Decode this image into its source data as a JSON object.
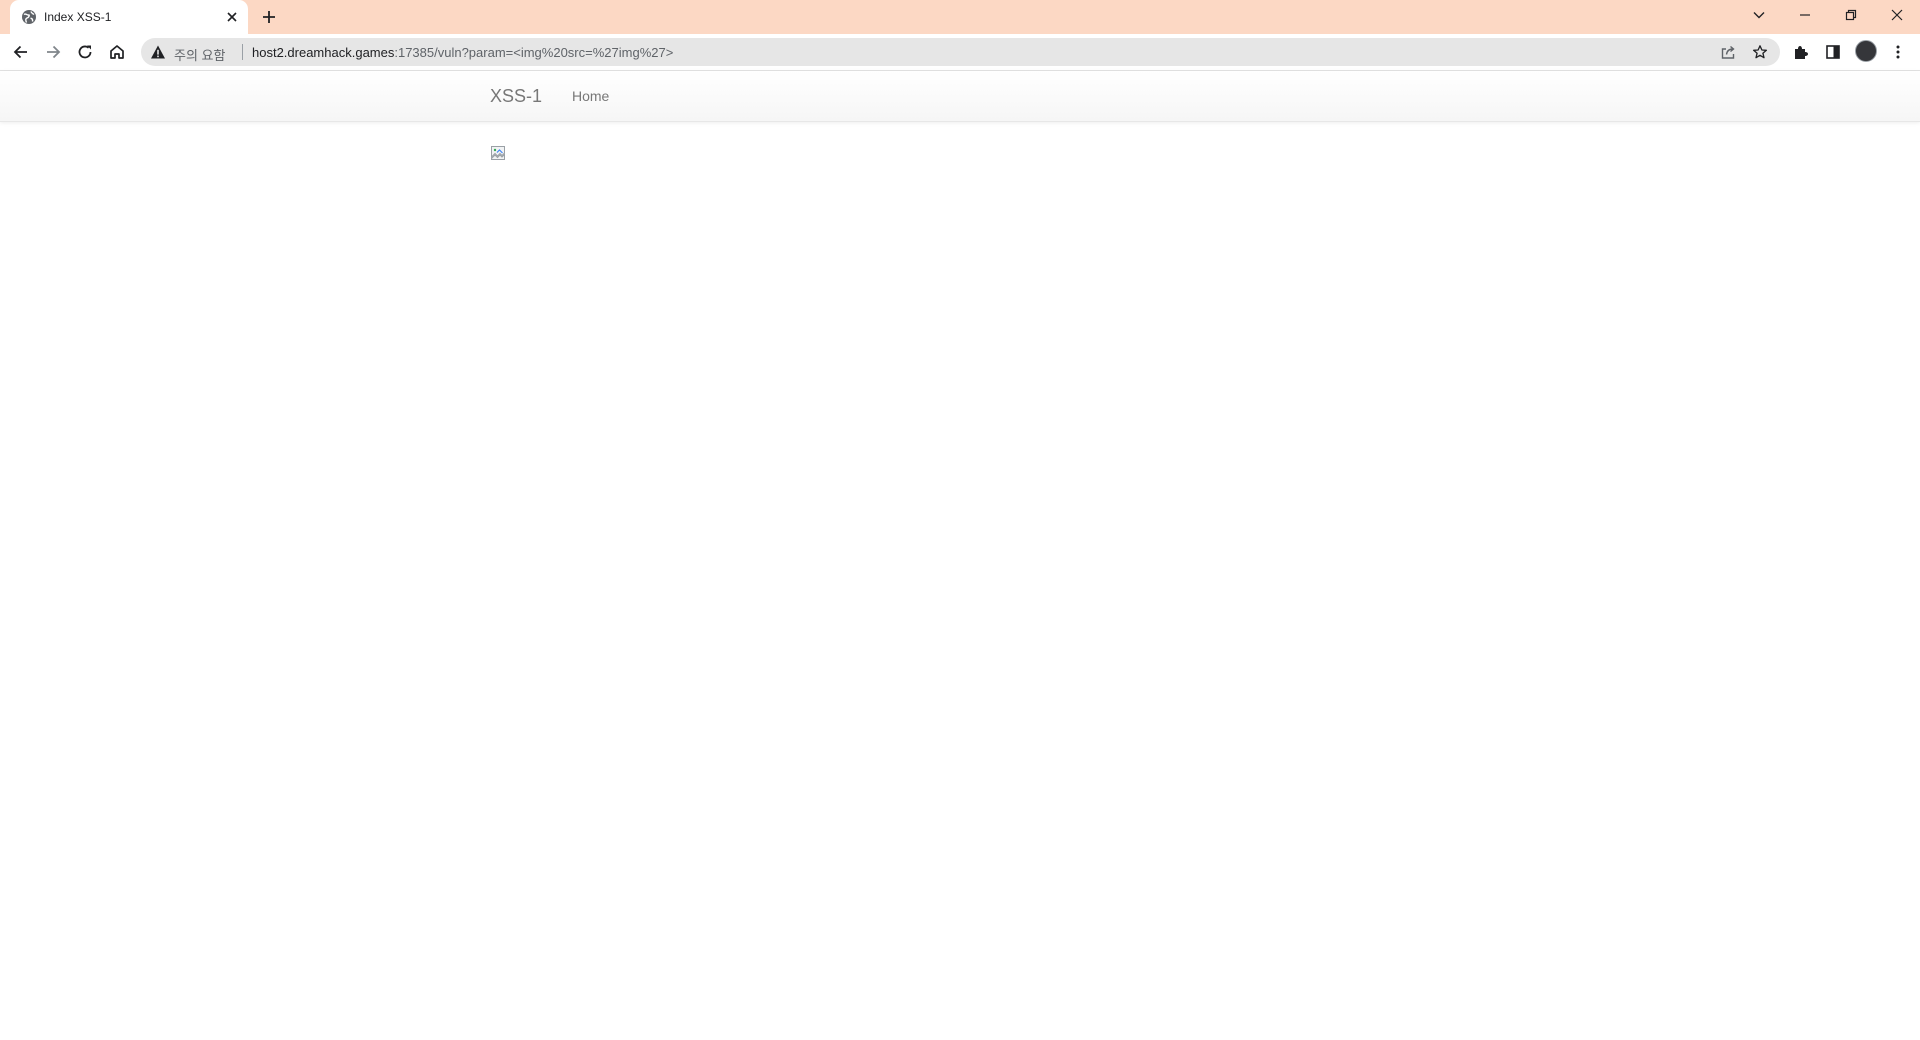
{
  "browser": {
    "tab": {
      "title": "Index XSS-1"
    },
    "address_bar": {
      "security_label": "주의 요함",
      "host": "host2.dreamhack.games",
      "path": ":17385/vuln?param=<img%20src=%27img%27>"
    },
    "colors": {
      "tabstrip": "#fcd8c4",
      "omnibox": "#e6e6e6"
    }
  },
  "page": {
    "navbar": {
      "brand": "XSS-1",
      "links": [
        "Home"
      ]
    }
  }
}
